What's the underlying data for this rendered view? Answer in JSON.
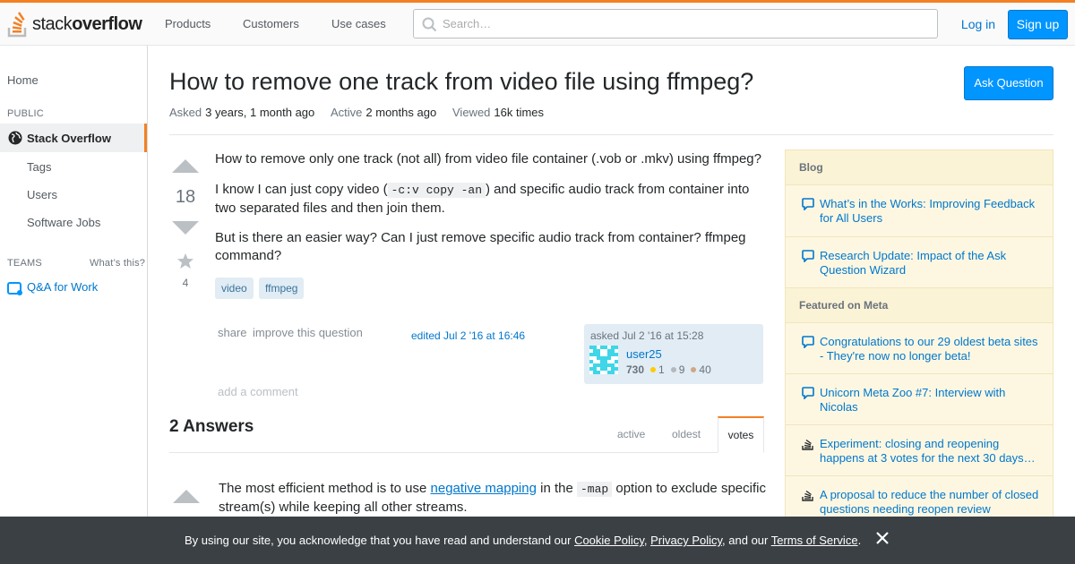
{
  "header": {
    "logo_light": "stack",
    "logo_bold": "overflow",
    "nav": [
      "Products",
      "Customers",
      "Use cases"
    ],
    "search_placeholder": "Search…",
    "login": "Log in",
    "signup": "Sign up",
    "accent_color": "#f48024"
  },
  "leftnav": {
    "home": "Home",
    "public_label": "PUBLIC",
    "stack_overflow": "Stack Overflow",
    "tags": "Tags",
    "users": "Users",
    "jobs": "Software Jobs",
    "teams_label": "TEAMS",
    "whats_this": "What’s this?",
    "qa_for_work": "Q&A for Work"
  },
  "question": {
    "title": "How to remove one track from video file using ffmpeg?",
    "ask_button": "Ask Question",
    "asked_label": "Asked",
    "asked_value": "3 years, 1 month ago",
    "active_label": "Active",
    "active_value": "2 months ago",
    "viewed_label": "Viewed",
    "viewed_value": "16k times",
    "votes": "18",
    "favorites": "4",
    "body": {
      "p1": "How to remove only one track (not all) from video file container (.vob or .mkv) using ffmpeg?",
      "p2_before": "I know I can just copy video (",
      "p2_code": "-c:v copy -an",
      "p2_after": ") and specific audio track from container into two separated files and then join them.",
      "p3": "But is there an easier way? Can I just remove specific audio track from container? ffmpeg command?"
    },
    "tags": [
      "video",
      "ffmpeg"
    ],
    "share": "share",
    "improve": "improve this question",
    "edited": "edited Jul 2 '16 at 16:46",
    "owner": {
      "asked": "asked Jul 2 '16 at 15:28",
      "name": "user25",
      "rep": "730",
      "gold": "1",
      "silver": "9",
      "bronze": "40"
    },
    "add_comment": "add a comment"
  },
  "answers": {
    "heading": "2 Answers",
    "tabs": [
      "active",
      "oldest",
      "votes"
    ],
    "first": {
      "before": "The most efficient method is to use ",
      "link": "negative mapping",
      "middle": " in the ",
      "code": "-map",
      "after": " option to exclude specific stream(s) while keeping all other streams."
    }
  },
  "sidebar": {
    "blog_heading": "Blog",
    "blog_items": [
      "What’s in the Works: Improving Feedback for All Users",
      "Research Update: Impact of the Ask Question Wizard"
    ],
    "meta_heading": "Featured on Meta",
    "meta_items": [
      "Congratulations to our 29 oldest beta sites - They're now no longer beta!",
      "Unicorn Meta Zoo #7: Interview with Nicolas",
      "Experiment: closing and reopening happens at 3 votes for the next 30 days…",
      "A proposal to reduce the number of closed questions needing reopen review"
    ]
  },
  "cookie": {
    "before": "By using our site, you acknowledge that you have read and understand our ",
    "cookie_policy": "Cookie Policy",
    "comma": ", ",
    "privacy_policy": "Privacy Policy",
    "and": ", and our ",
    "terms": "Terms of Service",
    "period": "."
  }
}
